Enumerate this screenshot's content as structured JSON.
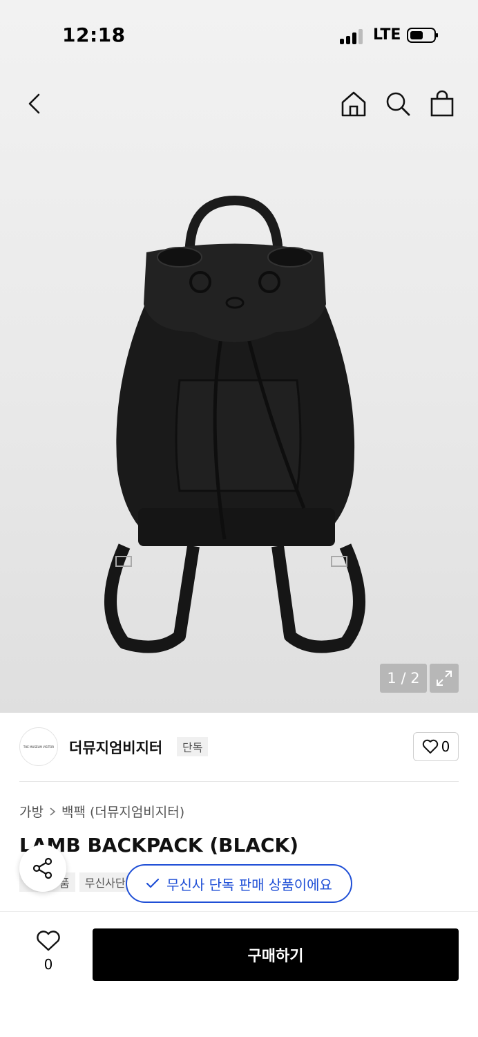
{
  "status_bar": {
    "time": "12:18",
    "network": "LTE"
  },
  "gallery": {
    "pager": "1 / 2"
  },
  "brand": {
    "logo_text": "THE MUSEUM VISITOR",
    "name": "더뮤지엄비지터",
    "tag": "단독",
    "like_count": "0"
  },
  "breadcrumb": {
    "category": "가방",
    "subcategory": "백팩 (더뮤지엄비지터)"
  },
  "product": {
    "title": "LAMB BACKPACK (BLACK)",
    "tags": [
      "품",
      "무신사단"
    ]
  },
  "toast": {
    "message": "무신사 단독 판매 상품이에요"
  },
  "bottom": {
    "wish_count": "0",
    "buy_label": "구매하기"
  },
  "icons": [
    "back-icon",
    "home-icon",
    "search-icon",
    "cart-icon",
    "expand-icon",
    "heart-icon",
    "share-icon",
    "check-icon"
  ],
  "colors": {
    "accent": "#1f4fd6",
    "buy_button": "#000000"
  }
}
